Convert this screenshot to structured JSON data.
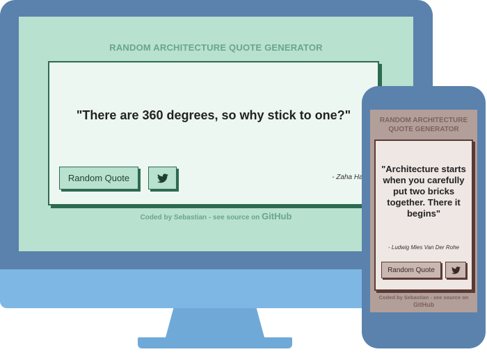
{
  "desktop": {
    "title": "RANDOM ARCHITECTURE QUOTE GENERATOR",
    "quote": "\"There are 360 degrees, so why stick to one?\"",
    "author": "- Zaha Hadid",
    "random_quote_button": "Random Quote",
    "twitter_icon": "twitter-icon",
    "footer_text": "Coded by Sebastian - see source on",
    "footer_link": "GitHub",
    "colors": {
      "background": "#b8e1cf",
      "card": "#edf7f2",
      "accent": "#2d6b50"
    }
  },
  "mobile": {
    "title": "RANDOM ARCHITECTURE QUOTE GENERATOR",
    "quote": "\"Architecture starts when you carefully put two bricks together. There it begins\"",
    "author": "- Ludwig Mies Van Der Rohe",
    "random_quote_button": "Random Quote",
    "twitter_icon": "twitter-icon",
    "footer_text": "Coded by Sebastian - see source on",
    "footer_link": "GitHub",
    "colors": {
      "background": "#b39f9a",
      "card": "#efe7e4",
      "accent": "#5a3a33"
    }
  }
}
